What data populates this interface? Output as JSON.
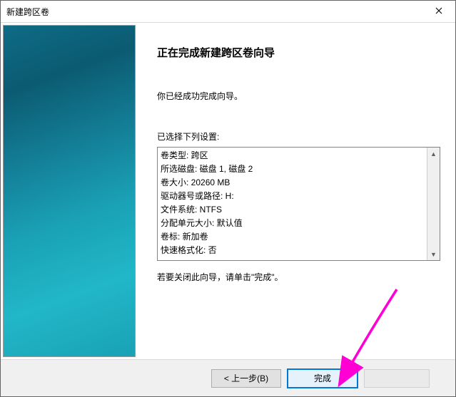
{
  "title": "新建跨区卷",
  "heading": "正在完成新建跨区卷向导",
  "lead": "你已经成功完成向导。",
  "sub": "已选择下列设置:",
  "settings": [
    "卷类型: 跨区",
    "所选磁盘: 磁盘 1, 磁盘 2",
    "卷大小: 20260 MB",
    "驱动器号或路径: H:",
    "文件系统: NTFS",
    "分配单元大小: 默认值",
    "卷标: 新加卷",
    "快速格式化: 否"
  ],
  "hint": "若要关闭此向导，请单击\"完成\"。",
  "buttons": {
    "back": "< 上一步(B)",
    "finish": "完成",
    "cancel": ""
  }
}
